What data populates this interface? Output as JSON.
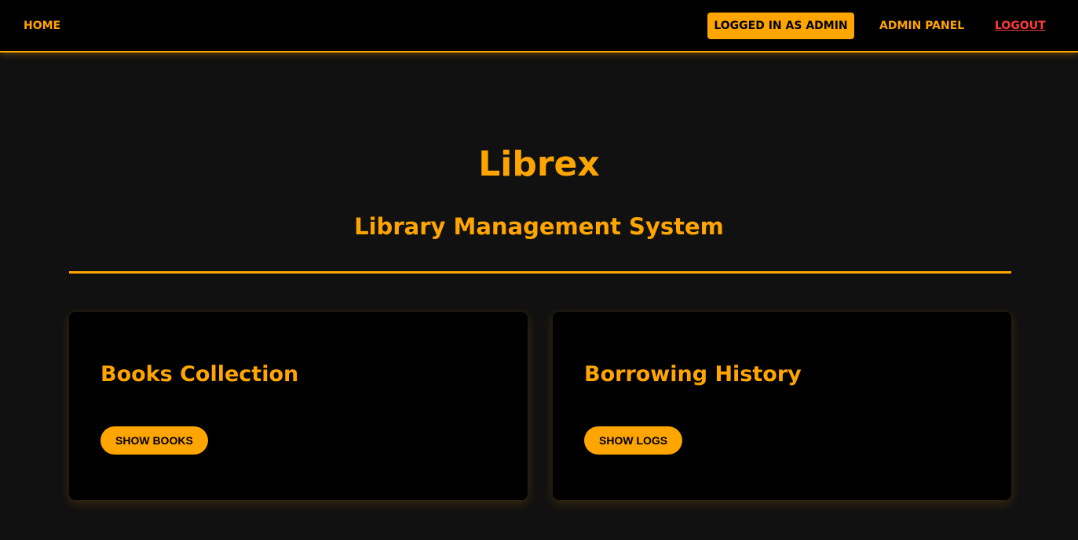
{
  "nav": {
    "home": "HOME",
    "status_badge": "LOGGED IN AS ADMIN",
    "admin_panel": "ADMIN PANEL",
    "logout": "LOGOUT"
  },
  "hero": {
    "title": "Librex",
    "subtitle": "Library Management System"
  },
  "cards": [
    {
      "title": "Books Collection",
      "button": "SHOW BOOKS"
    },
    {
      "title": "Borrowing History",
      "button": "SHOW LOGS"
    }
  ],
  "colors": {
    "accent": "#ffa500",
    "logout": "#ff3b3b",
    "page_background": "#111111",
    "nav_background": "#000000",
    "card_background": "#000000"
  }
}
